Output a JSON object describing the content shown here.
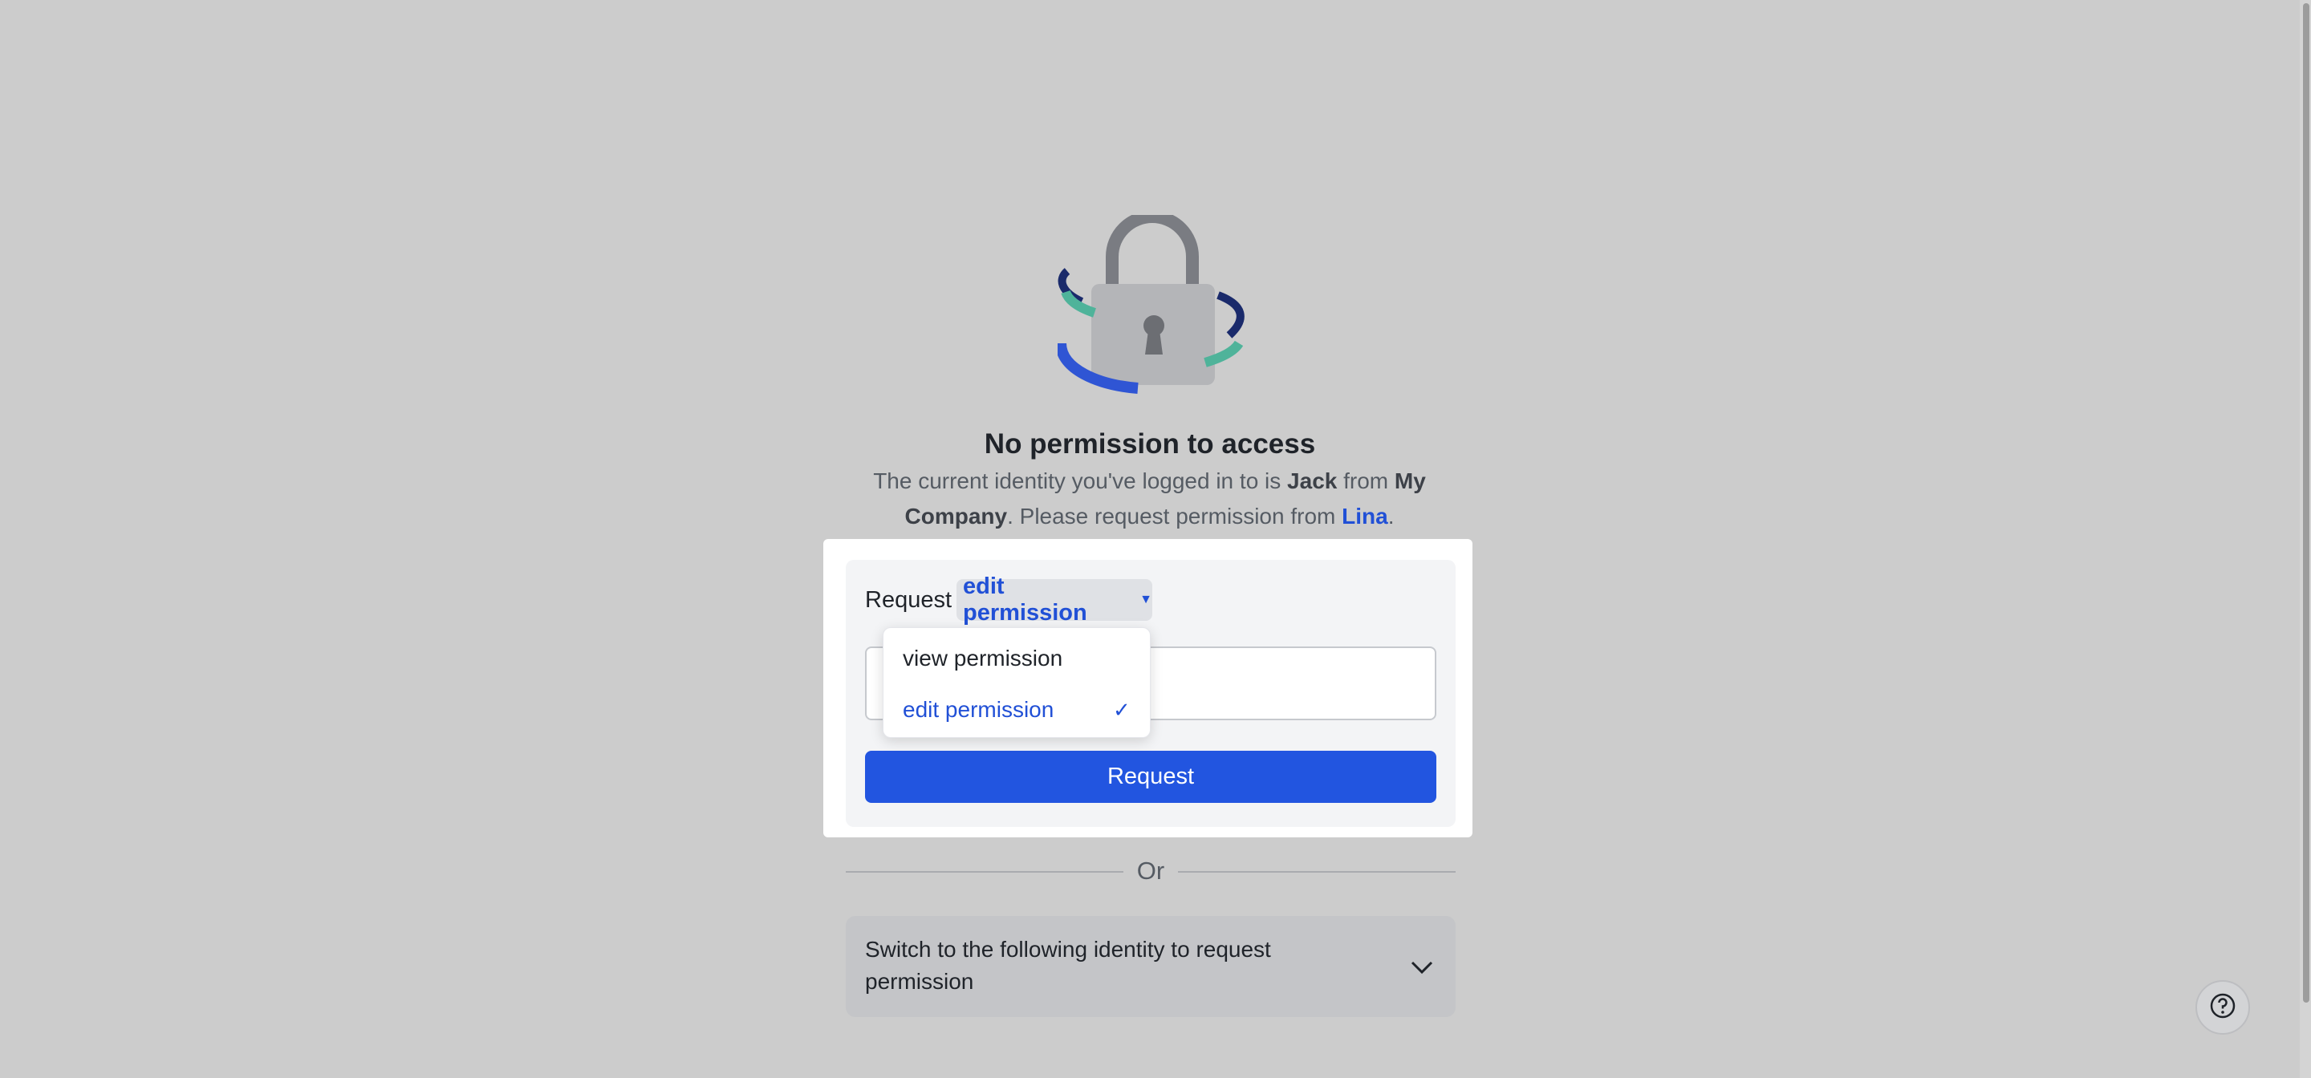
{
  "page": {
    "title": "No permission to access",
    "desc_prefix": "The current identity you've logged in to is ",
    "user_name": "Jack",
    "desc_from": " from ",
    "company_name": "My Company",
    "desc_middle": ". Please request permission from ",
    "owner_name": "Lina",
    "desc_end": "."
  },
  "request_card": {
    "label": "Request",
    "selected_permission": "edit permission",
    "textbox_value": "",
    "button_label": "Request"
  },
  "dropdown": {
    "options": [
      "view permission",
      "edit permission"
    ],
    "selected": "edit permission"
  },
  "divider": {
    "label": "Or"
  },
  "switch_identity": {
    "label": "Switch to the following identity to request permission"
  },
  "colors": {
    "accent": "#2255e0",
    "link": "#2150d6",
    "background": "#cccccc",
    "lock_teal": "#4fb39a",
    "lock_navy": "#1a2a6b"
  },
  "icons": [
    "lock-illustration",
    "caret-down-icon",
    "check-icon",
    "chevron-down-icon",
    "help-icon"
  ]
}
